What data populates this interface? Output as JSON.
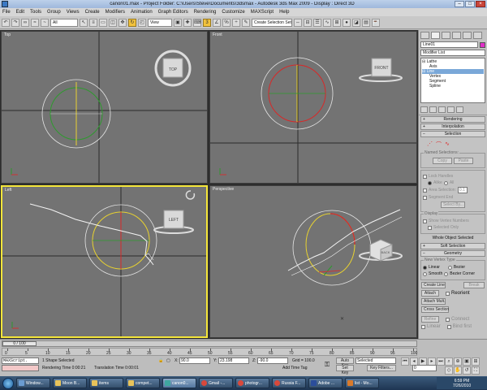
{
  "window": {
    "title": "canon01.max  -  Project Folder: C:\\Users\\Steve\\Documents\\3dsmax  -  Autodesk 3ds Max  2009  -  Display : Direct 3D"
  },
  "menu": [
    "File",
    "Edit",
    "Tools",
    "Group",
    "Views",
    "Create",
    "Modifiers",
    "Animation",
    "Graph Editors",
    "Rendering",
    "Customize",
    "MAXScript",
    "Help"
  ],
  "toolbar": {
    "filter": "All",
    "refcoord": "View",
    "named_sel": "Create Selection Set"
  },
  "viewports": {
    "top": "Top",
    "front": "Front",
    "left": "Left",
    "perspective": "Perspective"
  },
  "viewcube": {
    "top": "TOP",
    "front": "FRONT",
    "left": "LEFT",
    "back": "BACK"
  },
  "command_panel": {
    "object_name": "Line01",
    "swatch_color": "#e02fc8",
    "modifier_list": "Modifier List",
    "stack": [
      "Lathe",
      "Axis",
      "Line",
      "Vertex",
      "Segment",
      "Spline"
    ],
    "rollouts": [
      "Rendering",
      "Interpolation",
      "Selection"
    ],
    "selection": {
      "named_selections": "Named Selections:",
      "copy": "Copy",
      "paste": "Paste",
      "lock_handles": "Lock Handles",
      "alike": "Alike",
      "all": "All",
      "area_selection": "Area Selection:",
      "area_value": "0.1",
      "segment_end": "Segment End",
      "select_by": "Select By...",
      "display": "Display",
      "show_vertex_numbers": "Show Vertex Numbers",
      "selected_only": "Selected Only",
      "whole_object_selected": "Whole Object Selected"
    },
    "rollouts2": [
      "Soft Selection",
      "Geometry"
    ],
    "geometry": {
      "new_vertex_type": "New Vertex Type",
      "linear": "Linear",
      "bezier": "Bezier",
      "smooth": "Smooth",
      "bezier_corner": "Bezier Corner",
      "create_line": "Create Line",
      "break": "Break",
      "attach": "Attach",
      "reorient": "Reorient",
      "attach_mult": "Attach Mult.",
      "cross_section": "Cross Section",
      "refine": "Refine",
      "connect": "Connect",
      "linear2": "Linear",
      "bind_first": "Bind first"
    }
  },
  "timeline": {
    "frame": "0 / 100",
    "ticks": [
      "0",
      "5",
      "10",
      "15",
      "20",
      "25",
      "30",
      "35",
      "40",
      "45",
      "50",
      "55",
      "60",
      "65",
      "70",
      "75",
      "80",
      "85",
      "90",
      "95",
      "100"
    ]
  },
  "status": {
    "maxscript": "MAXScript.",
    "selection": "1 Shape Selected",
    "render_time": "Rendering Time  0:00:21",
    "translation_time": "Translation Time  0:00:01",
    "x_label": "X:",
    "x": "90.0",
    "y_label": "Y:",
    "y": "23.198",
    "z_label": "Z:",
    "z": "-90.0",
    "grid": "Grid = 100.0",
    "add_time_tag": "Add Time Tag",
    "auto_key": "Auto Key",
    "set_key": "Set Key",
    "selected": "Selected",
    "key_filters": "Key Filters...",
    "frame_field": "0"
  },
  "taskbar": {
    "items": [
      "Window...",
      "Moon B...",
      "items",
      "compet...",
      "canon0...",
      "Gmail -...",
      "photogr...",
      "Russia F...",
      "Adobe ...",
      "list - Mo..."
    ],
    "time": "6:59 PM",
    "date": "7/26/2010"
  }
}
